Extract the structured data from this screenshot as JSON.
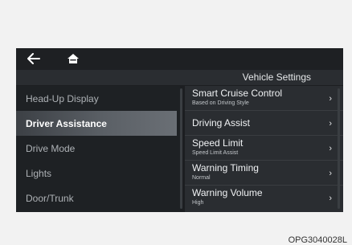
{
  "topbar": {
    "back_icon": "back-arrow-icon",
    "home_icon": "home-icon"
  },
  "header": {
    "title": "Vehicle Settings"
  },
  "left_menu": [
    {
      "label": "Head-Up Display",
      "selected": false
    },
    {
      "label": "Driver Assistance",
      "selected": true
    },
    {
      "label": "Drive Mode",
      "selected": false
    },
    {
      "label": "Lights",
      "selected": false
    },
    {
      "label": "Door/Trunk",
      "selected": false
    }
  ],
  "right_menu": [
    {
      "label": "Smart Cruise Control",
      "sub": "Based on Driving Style",
      "chevron": "›"
    },
    {
      "label": "Driving Assist",
      "sub": "",
      "chevron": "›"
    },
    {
      "label": "Speed Limit",
      "sub": "Speed Limit Assist",
      "chevron": "›"
    },
    {
      "label": "Warning Timing",
      "sub": "Normal",
      "chevron": "›"
    },
    {
      "label": "Warning Volume",
      "sub": "High",
      "chevron": "›"
    }
  ],
  "figure_code": "OPG3040028L",
  "colors": {
    "screen_bg": "#1c1e21",
    "selected_highlight": "#5b6066",
    "text": "#f0f2f4"
  }
}
